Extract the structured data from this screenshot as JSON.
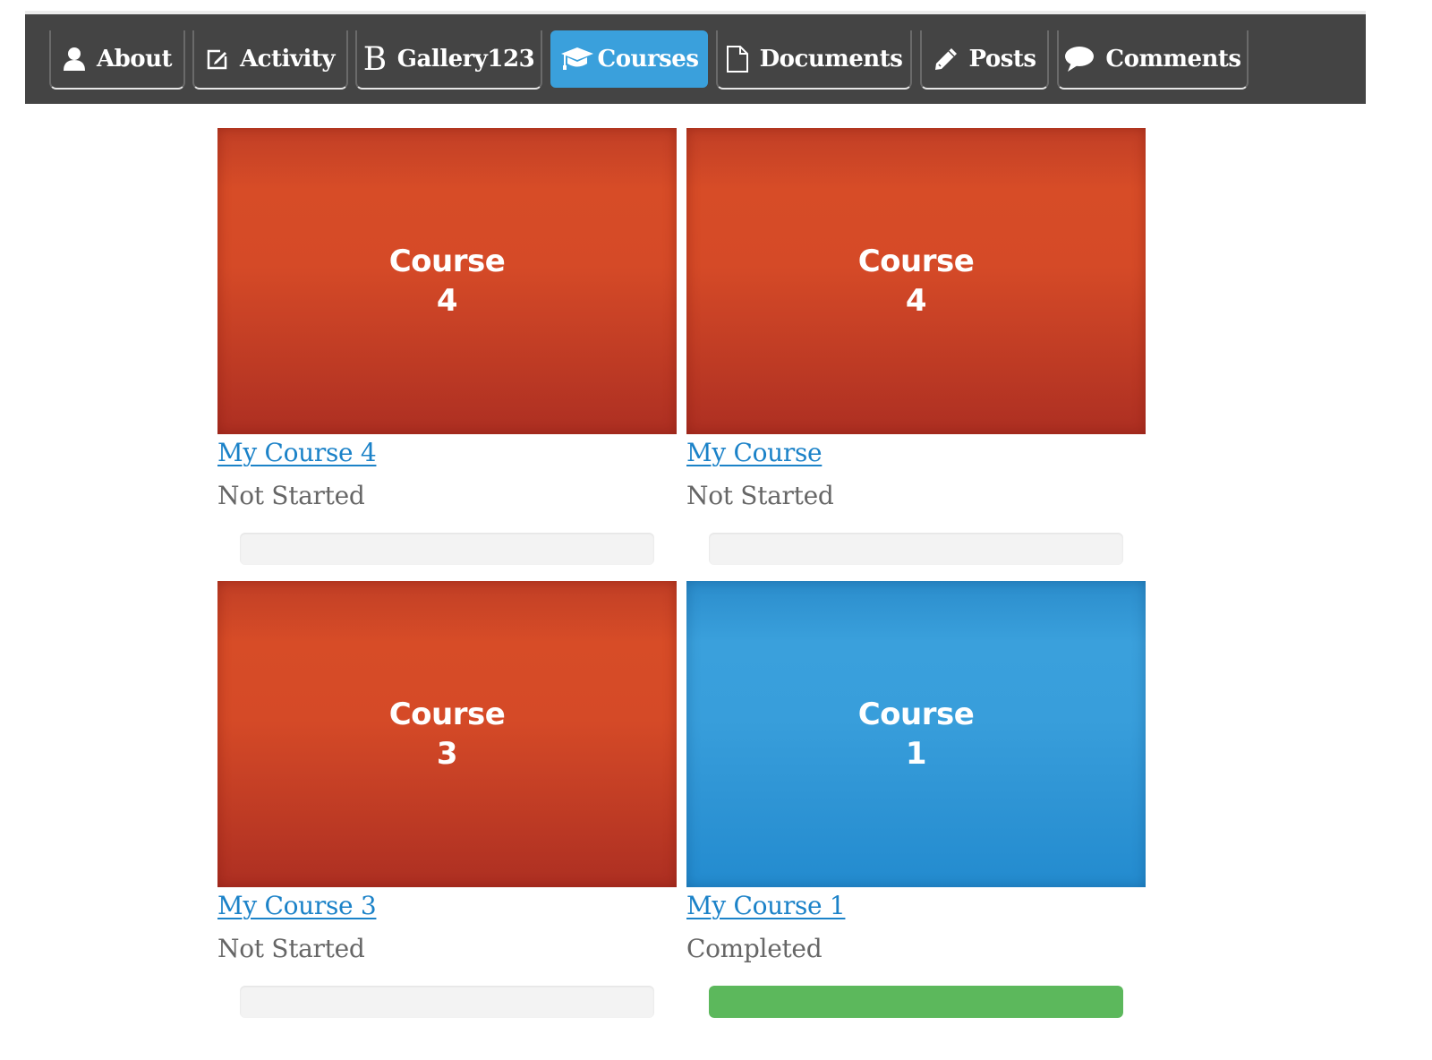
{
  "nav": {
    "items": [
      {
        "label": "About",
        "icon": "user-icon",
        "active": false
      },
      {
        "label": "Activity",
        "icon": "edit-icon",
        "active": false
      },
      {
        "label": "Gallery123",
        "icon": "b-letter-icon",
        "icon_glyph": "B",
        "active": false
      },
      {
        "label": "Courses",
        "icon": "graduation-cap-icon",
        "active": true
      },
      {
        "label": "Documents",
        "icon": "document-icon",
        "active": false
      },
      {
        "label": "Posts",
        "icon": "pencil-icon",
        "active": false
      },
      {
        "label": "Comments",
        "icon": "comment-icon",
        "active": false
      }
    ],
    "background_color": "#444444",
    "active_color": "#3aa0dc"
  },
  "courses": [
    {
      "thumb_line1": "Course",
      "thumb_line2": "4",
      "thumb_color": "red",
      "title": "My Course 4",
      "status": "Not Started",
      "progress_percent": 0
    },
    {
      "thumb_line1": "Course",
      "thumb_line2": "4",
      "thumb_color": "red",
      "title": "My Course",
      "status": "Not Started",
      "progress_percent": 0
    },
    {
      "thumb_line1": "Course",
      "thumb_line2": "3",
      "thumb_color": "red",
      "title": "My Course 3",
      "status": "Not Started",
      "progress_percent": 0
    },
    {
      "thumb_line1": "Course",
      "thumb_line2": "1",
      "thumb_color": "blue",
      "title": "My Course 1",
      "status": "Completed",
      "progress_percent": 100
    }
  ],
  "colors": {
    "link": "#1b82c8",
    "status_text": "#666666",
    "progress_track": "#f3f3f3",
    "progress_complete": "#5cb85c"
  }
}
